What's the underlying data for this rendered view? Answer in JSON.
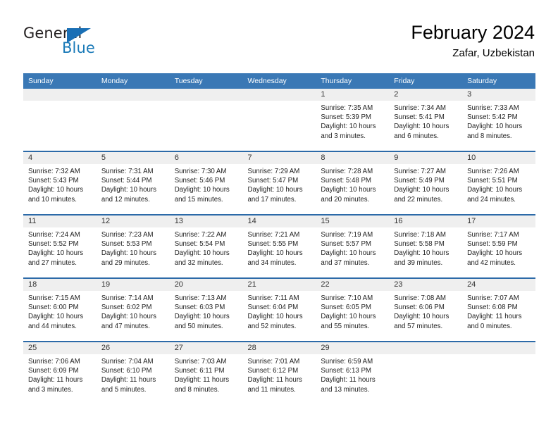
{
  "logo": {
    "word_top": "General",
    "word_bottom": "Blue",
    "triangle_icon": "triangle-icon",
    "accent_color": "#1a7ab8"
  },
  "header": {
    "title": "February 2024",
    "subtitle": "Zafar, Uzbekistan"
  },
  "theme": {
    "header_blue": "#3a78b5",
    "row_divider_blue": "#2c6aa8",
    "date_band_gray": "#efefef"
  },
  "calendar": {
    "weekday_headers": [
      "Sunday",
      "Monday",
      "Tuesday",
      "Wednesday",
      "Thursday",
      "Friday",
      "Saturday"
    ],
    "weeks": [
      [
        {
          "day": "",
          "empty": true
        },
        {
          "day": "",
          "empty": true
        },
        {
          "day": "",
          "empty": true
        },
        {
          "day": "",
          "empty": true
        },
        {
          "day": "1",
          "sunrise": "Sunrise: 7:35 AM",
          "sunset": "Sunset: 5:39 PM",
          "daylight_line1": "Daylight: 10 hours",
          "daylight_line2": "and 3 minutes."
        },
        {
          "day": "2",
          "sunrise": "Sunrise: 7:34 AM",
          "sunset": "Sunset: 5:41 PM",
          "daylight_line1": "Daylight: 10 hours",
          "daylight_line2": "and 6 minutes."
        },
        {
          "day": "3",
          "sunrise": "Sunrise: 7:33 AM",
          "sunset": "Sunset: 5:42 PM",
          "daylight_line1": "Daylight: 10 hours",
          "daylight_line2": "and 8 minutes."
        }
      ],
      [
        {
          "day": "4",
          "sunrise": "Sunrise: 7:32 AM",
          "sunset": "Sunset: 5:43 PM",
          "daylight_line1": "Daylight: 10 hours",
          "daylight_line2": "and 10 minutes."
        },
        {
          "day": "5",
          "sunrise": "Sunrise: 7:31 AM",
          "sunset": "Sunset: 5:44 PM",
          "daylight_line1": "Daylight: 10 hours",
          "daylight_line2": "and 12 minutes."
        },
        {
          "day": "6",
          "sunrise": "Sunrise: 7:30 AM",
          "sunset": "Sunset: 5:46 PM",
          "daylight_line1": "Daylight: 10 hours",
          "daylight_line2": "and 15 minutes."
        },
        {
          "day": "7",
          "sunrise": "Sunrise: 7:29 AM",
          "sunset": "Sunset: 5:47 PM",
          "daylight_line1": "Daylight: 10 hours",
          "daylight_line2": "and 17 minutes."
        },
        {
          "day": "8",
          "sunrise": "Sunrise: 7:28 AM",
          "sunset": "Sunset: 5:48 PM",
          "daylight_line1": "Daylight: 10 hours",
          "daylight_line2": "and 20 minutes."
        },
        {
          "day": "9",
          "sunrise": "Sunrise: 7:27 AM",
          "sunset": "Sunset: 5:49 PM",
          "daylight_line1": "Daylight: 10 hours",
          "daylight_line2": "and 22 minutes."
        },
        {
          "day": "10",
          "sunrise": "Sunrise: 7:26 AM",
          "sunset": "Sunset: 5:51 PM",
          "daylight_line1": "Daylight: 10 hours",
          "daylight_line2": "and 24 minutes."
        }
      ],
      [
        {
          "day": "11",
          "sunrise": "Sunrise: 7:24 AM",
          "sunset": "Sunset: 5:52 PM",
          "daylight_line1": "Daylight: 10 hours",
          "daylight_line2": "and 27 minutes."
        },
        {
          "day": "12",
          "sunrise": "Sunrise: 7:23 AM",
          "sunset": "Sunset: 5:53 PM",
          "daylight_line1": "Daylight: 10 hours",
          "daylight_line2": "and 29 minutes."
        },
        {
          "day": "13",
          "sunrise": "Sunrise: 7:22 AM",
          "sunset": "Sunset: 5:54 PM",
          "daylight_line1": "Daylight: 10 hours",
          "daylight_line2": "and 32 minutes."
        },
        {
          "day": "14",
          "sunrise": "Sunrise: 7:21 AM",
          "sunset": "Sunset: 5:55 PM",
          "daylight_line1": "Daylight: 10 hours",
          "daylight_line2": "and 34 minutes."
        },
        {
          "day": "15",
          "sunrise": "Sunrise: 7:19 AM",
          "sunset": "Sunset: 5:57 PM",
          "daylight_line1": "Daylight: 10 hours",
          "daylight_line2": "and 37 minutes."
        },
        {
          "day": "16",
          "sunrise": "Sunrise: 7:18 AM",
          "sunset": "Sunset: 5:58 PM",
          "daylight_line1": "Daylight: 10 hours",
          "daylight_line2": "and 39 minutes."
        },
        {
          "day": "17",
          "sunrise": "Sunrise: 7:17 AM",
          "sunset": "Sunset: 5:59 PM",
          "daylight_line1": "Daylight: 10 hours",
          "daylight_line2": "and 42 minutes."
        }
      ],
      [
        {
          "day": "18",
          "sunrise": "Sunrise: 7:15 AM",
          "sunset": "Sunset: 6:00 PM",
          "daylight_line1": "Daylight: 10 hours",
          "daylight_line2": "and 44 minutes."
        },
        {
          "day": "19",
          "sunrise": "Sunrise: 7:14 AM",
          "sunset": "Sunset: 6:02 PM",
          "daylight_line1": "Daylight: 10 hours",
          "daylight_line2": "and 47 minutes."
        },
        {
          "day": "20",
          "sunrise": "Sunrise: 7:13 AM",
          "sunset": "Sunset: 6:03 PM",
          "daylight_line1": "Daylight: 10 hours",
          "daylight_line2": "and 50 minutes."
        },
        {
          "day": "21",
          "sunrise": "Sunrise: 7:11 AM",
          "sunset": "Sunset: 6:04 PM",
          "daylight_line1": "Daylight: 10 hours",
          "daylight_line2": "and 52 minutes."
        },
        {
          "day": "22",
          "sunrise": "Sunrise: 7:10 AM",
          "sunset": "Sunset: 6:05 PM",
          "daylight_line1": "Daylight: 10 hours",
          "daylight_line2": "and 55 minutes."
        },
        {
          "day": "23",
          "sunrise": "Sunrise: 7:08 AM",
          "sunset": "Sunset: 6:06 PM",
          "daylight_line1": "Daylight: 10 hours",
          "daylight_line2": "and 57 minutes."
        },
        {
          "day": "24",
          "sunrise": "Sunrise: 7:07 AM",
          "sunset": "Sunset: 6:08 PM",
          "daylight_line1": "Daylight: 11 hours",
          "daylight_line2": "and 0 minutes."
        }
      ],
      [
        {
          "day": "25",
          "sunrise": "Sunrise: 7:06 AM",
          "sunset": "Sunset: 6:09 PM",
          "daylight_line1": "Daylight: 11 hours",
          "daylight_line2": "and 3 minutes."
        },
        {
          "day": "26",
          "sunrise": "Sunrise: 7:04 AM",
          "sunset": "Sunset: 6:10 PM",
          "daylight_line1": "Daylight: 11 hours",
          "daylight_line2": "and 5 minutes."
        },
        {
          "day": "27",
          "sunrise": "Sunrise: 7:03 AM",
          "sunset": "Sunset: 6:11 PM",
          "daylight_line1": "Daylight: 11 hours",
          "daylight_line2": "and 8 minutes."
        },
        {
          "day": "28",
          "sunrise": "Sunrise: 7:01 AM",
          "sunset": "Sunset: 6:12 PM",
          "daylight_line1": "Daylight: 11 hours",
          "daylight_line2": "and 11 minutes."
        },
        {
          "day": "29",
          "sunrise": "Sunrise: 6:59 AM",
          "sunset": "Sunset: 6:13 PM",
          "daylight_line1": "Daylight: 11 hours",
          "daylight_line2": "and 13 minutes."
        },
        {
          "day": "",
          "empty": true
        },
        {
          "day": "",
          "empty": true
        }
      ]
    ]
  }
}
